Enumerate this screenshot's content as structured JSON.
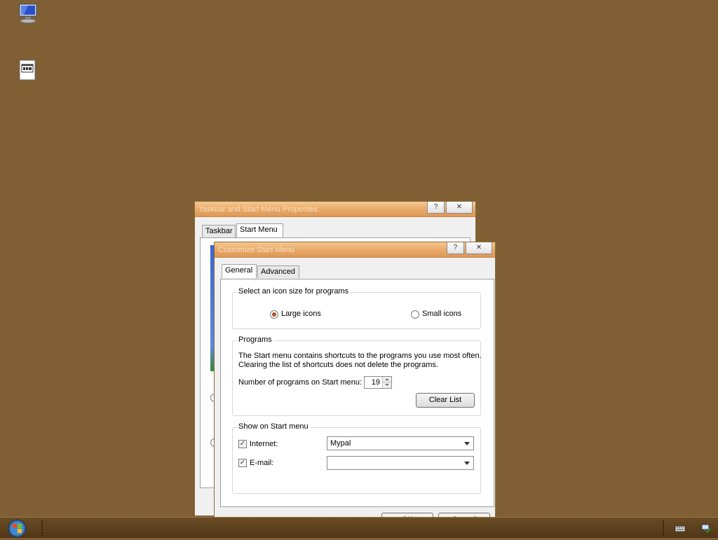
{
  "desktop": {
    "icons": [
      "computer-icon",
      "file-icon"
    ],
    "background": "#7f5f33"
  },
  "back_window": {
    "title": "Taskbar and Start Menu Properties",
    "help": "?",
    "close": "✕",
    "tabs": [
      "Taskbar",
      "Start Menu"
    ]
  },
  "dialog": {
    "title": "Customize Start Menu",
    "help": "?",
    "close": "✕",
    "tabs": [
      "General",
      "Advanced"
    ],
    "icon_size": {
      "legend": "Select an icon size for programs",
      "large": "Large icons",
      "small": "Small icons",
      "selected": "large"
    },
    "programs": {
      "legend": "Programs",
      "description_line1": "The Start menu contains shortcuts to the programs you use most often.",
      "description_line2": "Clearing the list of shortcuts does not delete the programs.",
      "count_label": "Number of programs on Start menu:",
      "count_value": "19",
      "clear_button": "Clear List"
    },
    "show": {
      "legend": "Show on Start menu",
      "internet_label": "Internet:",
      "internet_checked": true,
      "internet_value": "Mypal",
      "email_label": "E-mail:",
      "email_checked": true,
      "email_value": ""
    },
    "ok": "OK",
    "cancel": "Cancel"
  },
  "taskbar": {
    "color": "#5c4020"
  }
}
